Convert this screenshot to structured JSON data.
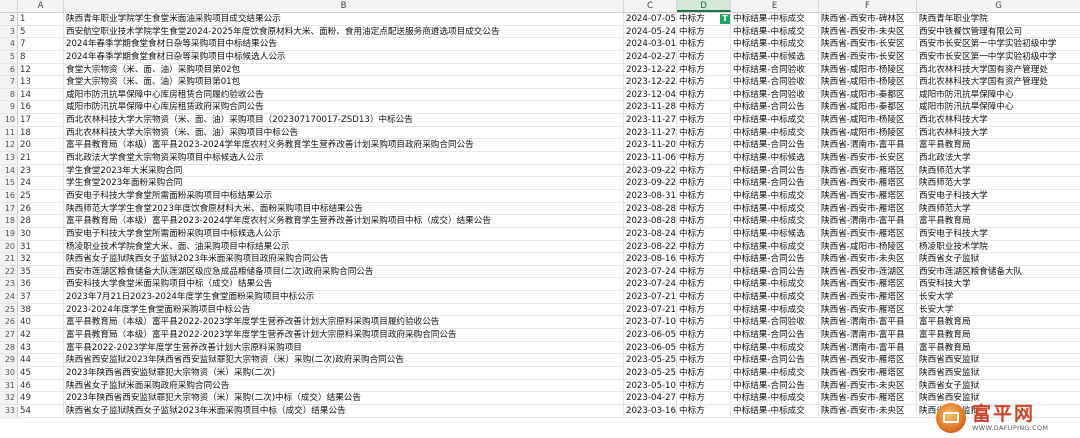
{
  "columns": [
    {
      "id": "rn",
      "label": ""
    },
    {
      "id": "A",
      "label": "A"
    },
    {
      "id": "B",
      "label": "B"
    },
    {
      "id": "C",
      "label": "C"
    },
    {
      "id": "D",
      "label": "D"
    },
    {
      "id": "E",
      "label": "E"
    },
    {
      "id": "F",
      "label": "F"
    },
    {
      "id": "G",
      "label": "G"
    }
  ],
  "rows": [
    {
      "rn": "2",
      "a": "1",
      "b": "陕西青年职业学院学生食堂米面油采购项目成交结果公示",
      "c": "2024-07-05",
      "d": "中标方",
      "e": "中标结果-中标成交",
      "f": "陕西省-西安市-碑林区",
      "g": "陕西青年职业学院",
      "flag": true
    },
    {
      "rn": "3",
      "a": "5",
      "b": "西安航空职业技术学院学生食堂2024-2025年度饮食原材料大米、面粉、食用油定点配送服务商遴选项目成交公告",
      "c": "2024-05-24",
      "d": "中标方",
      "e": "中标结果-中标成交",
      "f": "陕西省-西安市-未央区",
      "g": "西安中铁餐饮管理有限公司"
    },
    {
      "rn": "4",
      "a": "7",
      "b": "2024年春季学期食堂食材日杂等采购项目中标结果公告",
      "c": "2024-03-01",
      "d": "中标方",
      "e": "中标结果-中标成交",
      "f": "陕西省-西安市-长安区",
      "g": "西安市长安区第一中学实验初级中学"
    },
    {
      "rn": "5",
      "a": "8",
      "b": "2024年春季学期食堂食材日杂等采购项目中标候选人公示",
      "c": "2024-02-27",
      "d": "中标方",
      "e": "中标结果-中标候选",
      "f": "陕西省-西安市-长安区",
      "g": "西安市长安区第一中学实验初级中学"
    },
    {
      "rn": "6",
      "a": "12",
      "b": "食堂大宗物资（米、面、油）采购项目第02包",
      "c": "2023-12-22",
      "d": "中标方",
      "e": "中标结果-合同验收",
      "f": "陕西省-咸阳市-杨陵区",
      "g": "西北农林科技大学国有资产管理处"
    },
    {
      "rn": "7",
      "a": "13",
      "b": "食堂大宗物资（米、面、油）采购项目第01包",
      "c": "2023-12-22",
      "d": "中标方",
      "e": "中标结果-合同验收",
      "f": "陕西省-咸阳市-杨陵区",
      "g": "西北农林科技大学国有资产管理处"
    },
    {
      "rn": "8",
      "a": "14",
      "b": "咸阳市防汛抗旱保障中心库房租赁合同履约验收公告",
      "c": "2023-12-04",
      "d": "中标方",
      "e": "中标结果-合同验收",
      "f": "陕西省-咸阳市-秦都区",
      "g": "咸阳市防汛抗旱保障中心"
    },
    {
      "rn": "9",
      "a": "16",
      "b": "咸阳市防汛抗旱保障中心库房租赁政府采购合同公告",
      "c": "2023-11-28",
      "d": "中标方",
      "e": "中标结果-合同公告",
      "f": "陕西省-咸阳市-秦都区",
      "g": "咸阳市防汛抗旱保障中心"
    },
    {
      "rn": "10",
      "a": "17",
      "b": "西北农林科技大学大宗物资（米、面、油）采购项目（202307170017-ZSD13）中标公告",
      "c": "2023-11-27",
      "d": "中标方",
      "e": "中标结果-中标成交",
      "f": "陕西省-咸阳市-杨陵区",
      "g": "西北农林科技大学"
    },
    {
      "rn": "11",
      "a": "18",
      "b": "西北农林科技大学大宗物资（米、面、油）采购项目中标公告",
      "c": "2023-11-27",
      "d": "中标方",
      "e": "中标结果-中标成交",
      "f": "陕西省-咸阳市-杨陵区",
      "g": "西北农林科技大学"
    },
    {
      "rn": "12",
      "a": "20",
      "b": "富平县教育局（本级）富平县2023-2024学年度农村义务教育学生营养改善计划采购项目政府采购合同公告",
      "c": "2023-11-20",
      "d": "中标方",
      "e": "中标结果-合同公告",
      "f": "陕西省-渭南市-富平县",
      "g": "富平县教育局"
    },
    {
      "rn": "13",
      "a": "21",
      "b": "西北政法大学食堂大宗物资采购项目中标候选人公示",
      "c": "2023-11-06",
      "d": "中标方",
      "e": "中标结果-中标候选",
      "f": "陕西省-西安市-长安区",
      "g": "西北政法大学"
    },
    {
      "rn": "14",
      "a": "23",
      "b": "学生食堂2023年大米采购合同",
      "c": "2023-09-22",
      "d": "中标方",
      "e": "中标结果-合同公告",
      "f": "陕西省-西安市-雁塔区",
      "g": "陕西师范大学"
    },
    {
      "rn": "15",
      "a": "24",
      "b": "学生食堂2023年面粉采购合同",
      "c": "2023-09-22",
      "d": "中标方",
      "e": "中标结果-合同公告",
      "f": "陕西省-西安市-雁塔区",
      "g": "陕西师范大学"
    },
    {
      "rn": "16",
      "a": "25",
      "b": "西安电子科技大学食堂所需面粉采购项目中标结果公示",
      "c": "2023-08-31",
      "d": "中标方",
      "e": "中标结果-中标成交",
      "f": "陕西省-西安市-雁塔区",
      "g": "西安电子科技大学"
    },
    {
      "rn": "17",
      "a": "26",
      "b": "陕西师范大学学生食堂2023年度饮食原材料大米、面粉采购项目中标结果公告",
      "c": "2023-08-28",
      "d": "中标方",
      "e": "中标结果-中标成交",
      "f": "陕西省-西安市-雁塔区",
      "g": "陕西师范大学"
    },
    {
      "rn": "18",
      "a": "28",
      "b": "富平县教育局（本级）富平县2023-2024学年度农村义务教育学生营养改善计划采购项目中标（成交）结果公告",
      "c": "2023-08-28",
      "d": "中标方",
      "e": "中标结果-中标成交",
      "f": "陕西省-渭南市-富平县",
      "g": "富平县教育局"
    },
    {
      "rn": "19",
      "a": "30",
      "b": "西安电子科技大学食堂所需面粉采购项目中标候选人公示",
      "c": "2023-08-24",
      "d": "中标方",
      "e": "中标结果-中标候选",
      "f": "陕西省-西安市-雁塔区",
      "g": "西安电子科技大学"
    },
    {
      "rn": "20",
      "a": "31",
      "b": "杨凌职业技术学院食堂大米、面、油采购项目中标结果公示",
      "c": "2023-08-22",
      "d": "中标方",
      "e": "中标结果-中标成交",
      "f": "陕西省-咸阳市-杨陵区",
      "g": "杨凌职业技术学院"
    },
    {
      "rn": "21",
      "a": "32",
      "b": "陕西省女子监狱陕西女子监狱2023年米面采购项目政府采购合同公告",
      "c": "2023-08-16",
      "d": "中标方",
      "e": "中标结果-合同公告",
      "f": "陕西省-西安市-未央区",
      "g": "陕西省女子监狱"
    },
    {
      "rn": "22",
      "a": "35",
      "b": "西安市莲湖区粮食储备大队莲湖区级应急成品粮储备项目(二次)政府采购合同公告",
      "c": "2023-07-24",
      "d": "中标方",
      "e": "中标结果-合同公告",
      "f": "陕西省-西安市-莲湖区",
      "g": "西安市莲湖区粮食储备大队"
    },
    {
      "rn": "23",
      "a": "36",
      "b": "西安科技大学食堂米面采购项目中标（成交）结果公告",
      "c": "2023-07-24",
      "d": "中标方",
      "e": "中标结果-中标成交",
      "f": "陕西省-西安市-雁塔区",
      "g": "西安科技大学"
    },
    {
      "rn": "24",
      "a": "37",
      "b": "2023年7月21日2023-2024年度学生食堂面粉采购项目中标公示",
      "c": "2023-07-21",
      "d": "中标方",
      "e": "中标结果-中标成交",
      "f": "陕西省-西安市-雁塔区",
      "g": "长安大学"
    },
    {
      "rn": "25",
      "a": "38",
      "b": "2023-2024年度学生食堂面粉采购项目中标公告",
      "c": "2023-07-21",
      "d": "中标方",
      "e": "中标结果-中标成交",
      "f": "陕西省-西安市-雁塔区",
      "g": "长安大学"
    },
    {
      "rn": "26",
      "a": "40",
      "b": "富平县教育局（本级）富平县2022-2023学年度学生营养改善计划大宗原料采购项目履约验收公告",
      "c": "2023-07-10",
      "d": "中标方",
      "e": "中标结果-合同验收",
      "f": "陕西省-渭南市-富平县",
      "g": "富平县教育局"
    },
    {
      "rn": "27",
      "a": "42",
      "b": "富平县教育局（本级）富平县2022-2023学年度学生营养改善计划大宗原料采购项目政府采购合同公告",
      "c": "2023-06-05",
      "d": "中标方",
      "e": "中标结果-合同公告",
      "f": "陕西省-渭南市-富平县",
      "g": "富平县教育局"
    },
    {
      "rn": "28",
      "a": "43",
      "b": "富平县2022-2023学年度学生营养改善计划大宗原料采购项目",
      "c": "2023-06-05",
      "d": "中标方",
      "e": "中标结果-中标成交",
      "f": "陕西省-渭南市-富平县",
      "g": "富平县教育局"
    },
    {
      "rn": "29",
      "a": "44",
      "b": "陕西省西安监狱2023年陕西省西安监狱罪犯大宗物资（米）采购(二次)政府采购合同公告",
      "c": "2023-05-25",
      "d": "中标方",
      "e": "中标结果-合同公告",
      "f": "陕西省-西安市-雁塔区",
      "g": "陕西省西安监狱"
    },
    {
      "rn": "30",
      "a": "45",
      "b": "2023年陕西省西安监狱罪犯大宗物资（米）采购(二次)",
      "c": "2023-05-25",
      "d": "中标方",
      "e": "中标结果-中标成交",
      "f": "陕西省-西安市-雁塔区",
      "g": "陕西省西安监狱"
    },
    {
      "rn": "31",
      "a": "46",
      "b": "陕西省女子监狱米面采购政府采购合同公告",
      "c": "2023-05-10",
      "d": "中标方",
      "e": "中标结果-合同公告",
      "f": "陕西省-西安市-未央区",
      "g": "陕西省女子监狱"
    },
    {
      "rn": "32",
      "a": "49",
      "b": "2023年陕西省西安监狱罪犯大宗物资（米）采购(二次)中标（成交）结果公告",
      "c": "2023-04-27",
      "d": "中标方",
      "e": "中标结果-中标成交",
      "f": "陕西省-西安市-雁塔区",
      "g": "陕西省西安监狱"
    },
    {
      "rn": "33",
      "a": "54",
      "b": "陕西省女子监狱陕西女子监狱2023年米面采购项目中标（成交）结果公告",
      "c": "2023-03-16",
      "d": "中标方",
      "e": "中标结果-中标成交",
      "f": "陕西省-西安市-未央区",
      "g": "陕西省女子监狱"
    }
  ],
  "watermark": {
    "title": "富平网",
    "url": "WWW.DAFUPING.COM",
    "logo_icon": "house-logo-icon"
  },
  "colors": {
    "selected_col": "#217346",
    "flag": "#21a366"
  }
}
